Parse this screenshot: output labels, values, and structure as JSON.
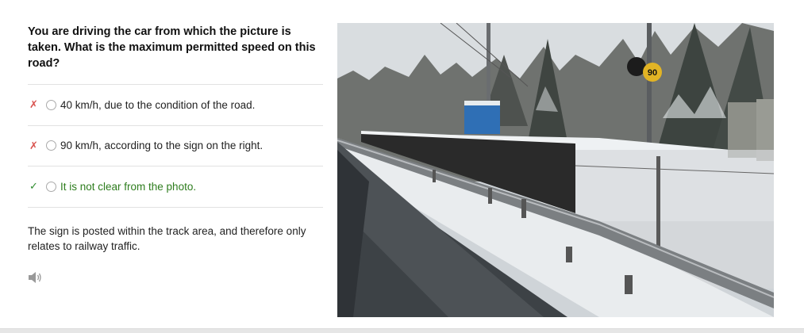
{
  "question": "You are driving the car from which the picture is taken. What is the maximum permitted speed on this road?",
  "answers": [
    {
      "mark": "✗",
      "text": "40 km/h, due to the condition of the road.",
      "correct": false
    },
    {
      "mark": "✗",
      "text": "90 km/h, according to the sign on the right.",
      "correct": false
    },
    {
      "mark": "✓",
      "text": "It is not clear from the photo.",
      "correct": true
    }
  ],
  "explanation": "The sign is posted within the track area, and therefore only relates to railway traffic.",
  "speaker_icon": "speaker-icon",
  "photo": {
    "sign_value": "90"
  },
  "colors": {
    "wrong": "#d9534f",
    "correct": "#2e7d1e",
    "divider": "#e2e2e2"
  }
}
